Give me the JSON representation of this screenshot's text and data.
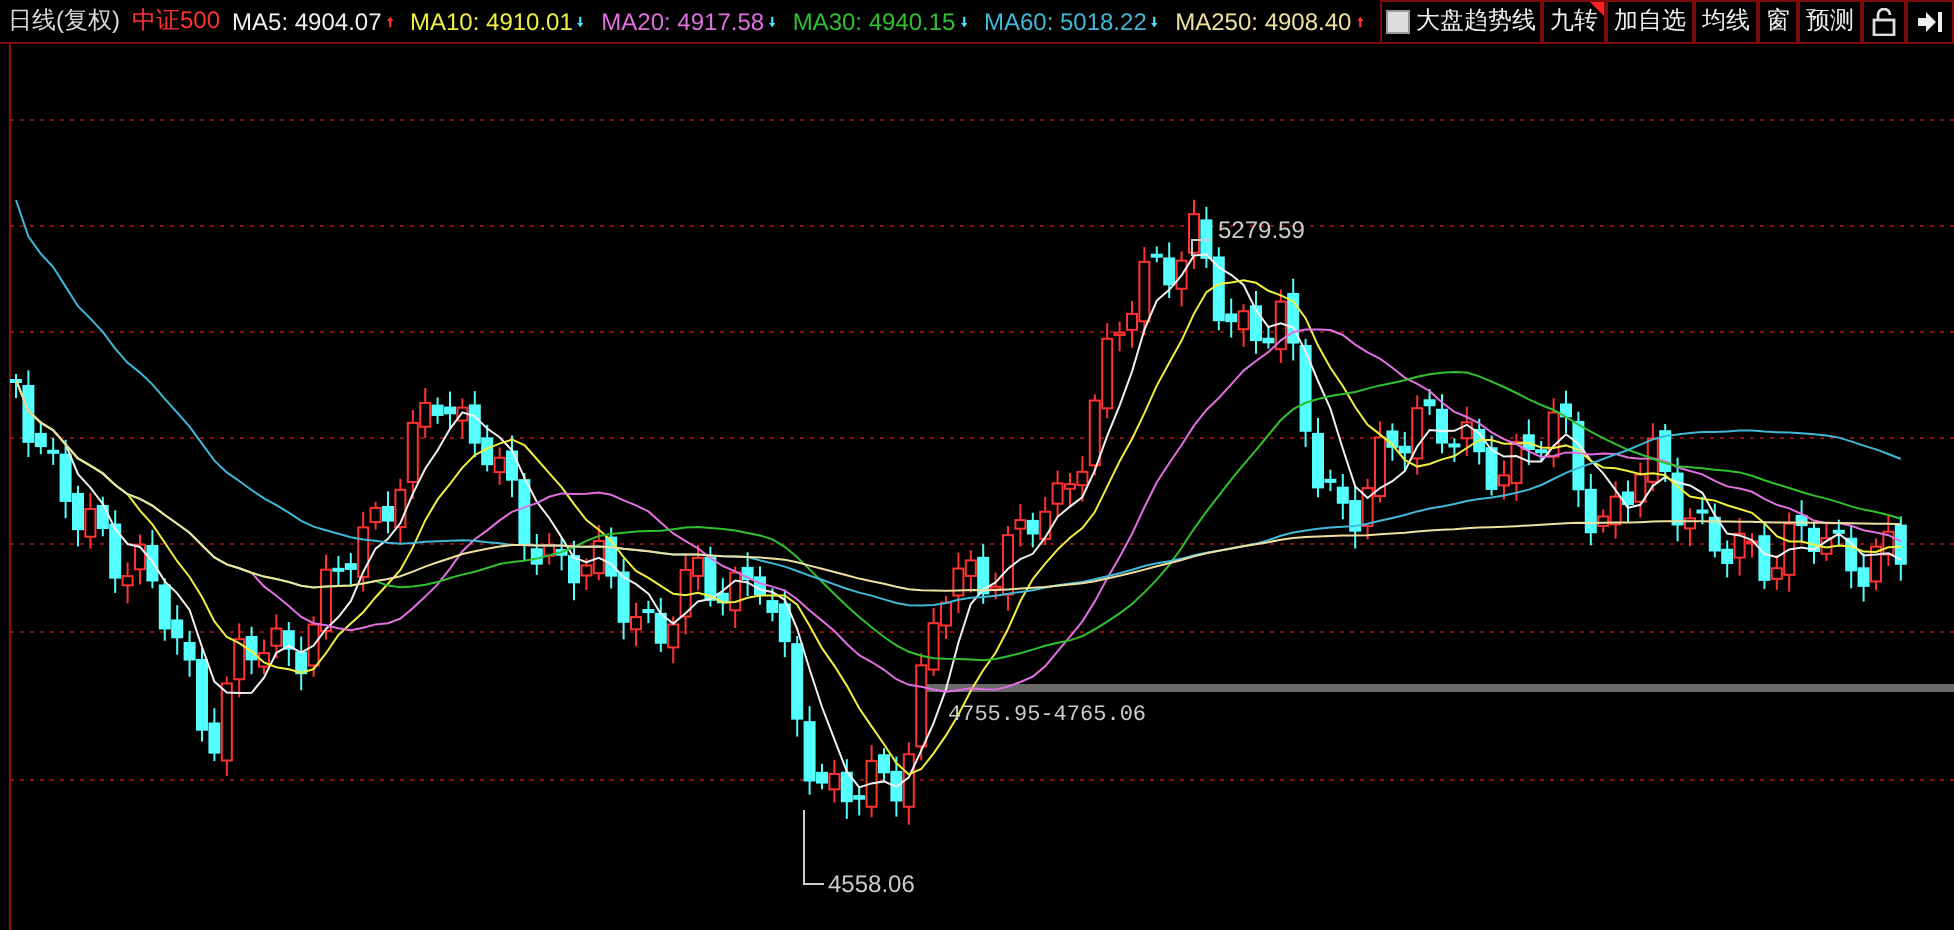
{
  "header": {
    "title": "日线(复权)",
    "index_name": "中证500",
    "indicators": [
      {
        "label": "MA5: 4904.07",
        "color": "#f0f0f0",
        "rising": true
      },
      {
        "label": "MA10: 4910.01",
        "color": "#f0f040",
        "rising": false
      },
      {
        "label": "MA20: 4917.58",
        "color": "#e070e0",
        "rising": false
      },
      {
        "label": "MA30: 4940.15",
        "color": "#30c030",
        "rising": false
      },
      {
        "label": "MA60: 5018.22",
        "color": "#40b8d8",
        "rising": false
      },
      {
        "label": "MA250: 4908.40",
        "color": "#f0e0a0",
        "rising": true
      }
    ],
    "trend_toggle": {
      "label": "大盘趋势线",
      "checked": false
    },
    "buttons": [
      {
        "label": "九转",
        "flagged": true
      },
      {
        "label": "加自选",
        "flagged": false
      },
      {
        "label": "均线",
        "flagged": false
      },
      {
        "label": "窗",
        "flagged": false
      },
      {
        "label": "预测",
        "flagged": false
      }
    ]
  },
  "chart": {
    "high_label": "5279.59",
    "low_label": "4558.06",
    "range_label": "4755.95-4765.06"
  }
}
